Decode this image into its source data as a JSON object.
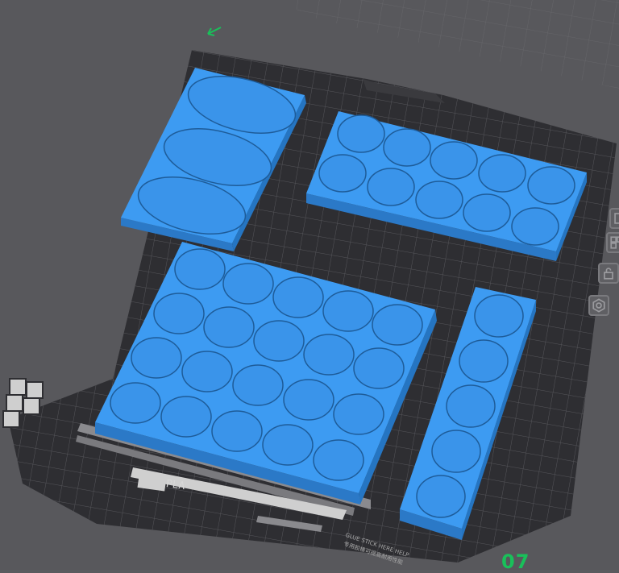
{
  "viewport": {
    "background_color": "#5a5a5e",
    "bed_color": "#2f2f33",
    "grid_color": "#4a4a4e",
    "part_color": "#3d9bf2",
    "part_side_color": "#2b79c7"
  },
  "bed": {
    "filament_label": "PLA",
    "plate_number": "07",
    "glue_notice_line1": "GLUE STICK HERE HELP",
    "glue_notice_line2": "专用胶棒可提高耐用性能"
  },
  "side_toolbar": {
    "items": [
      {
        "icon": "orient-icon"
      },
      {
        "icon": "arrange-icon"
      },
      {
        "icon": "lock-icon"
      },
      {
        "icon": "settings-gear-icon"
      }
    ]
  },
  "parts": [
    {
      "name": "tray-3-oval"
    },
    {
      "name": "tray-2x5-round"
    },
    {
      "name": "tray-5x4-round"
    },
    {
      "name": "tray-1x5-round"
    }
  ]
}
